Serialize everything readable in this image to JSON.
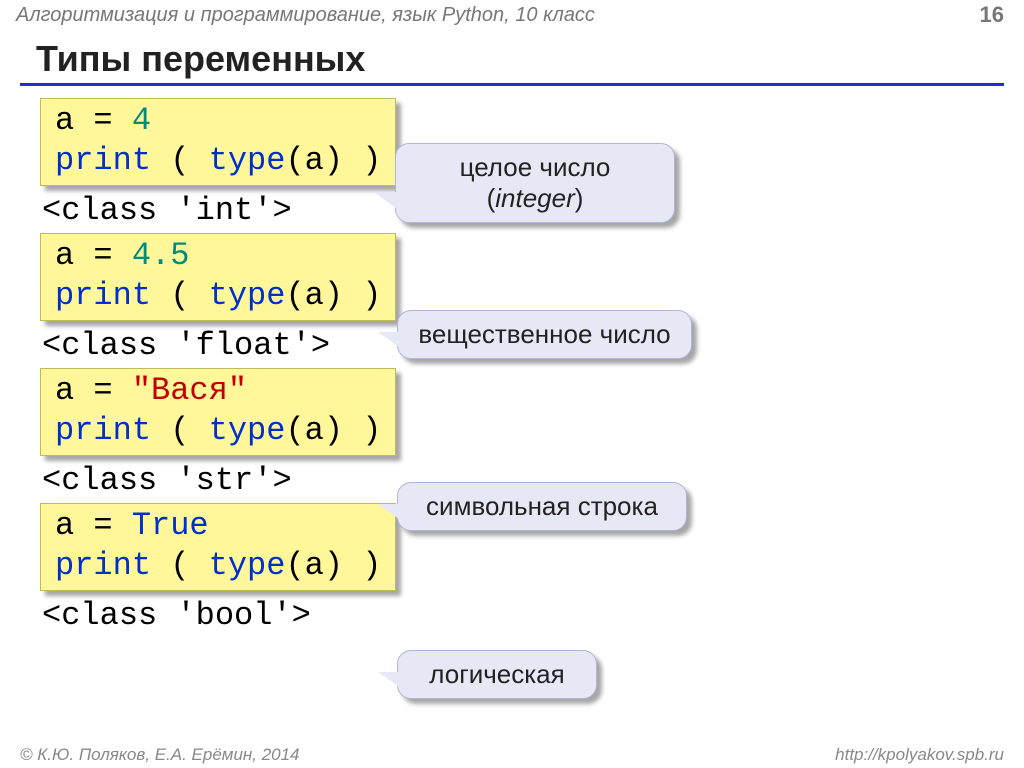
{
  "header": {
    "title": "Алгоритмизация и программирование, язык Python, 10 класс",
    "page": "16"
  },
  "title": "Типы переменных",
  "blocks": [
    {
      "code": {
        "l1_a": "a",
        "l1_eq": " = ",
        "l1_val": "4",
        "l2_print": "print",
        "l2_sp1": " ( ",
        "l2_type": "type",
        "l2_arg": "(a)",
        "l2_sp2": " )"
      },
      "out": "<class 'int'>",
      "bubble_l1": "целое число",
      "bubble_l2a": "(",
      "bubble_l2b": "integer",
      "bubble_l2c": ")"
    },
    {
      "code": {
        "l1_a": "a",
        "l1_eq": " = ",
        "l1_val": "4.5",
        "l2_print": "print",
        "l2_sp1": " ( ",
        "l2_type": "type",
        "l2_arg": "(a)",
        "l2_sp2": " )"
      },
      "out": "<class 'float'>",
      "bubble_l1": "вещественное число"
    },
    {
      "code": {
        "l1_a": "a",
        "l1_eq": " = ",
        "l1_val": "\"Вася\"",
        "l2_print": "print",
        "l2_sp1": " ( ",
        "l2_type": "type",
        "l2_arg": "(a)",
        "l2_sp2": " )"
      },
      "out": "<class 'str'>",
      "bubble_l1": "символьная строка"
    },
    {
      "code": {
        "l1_a": "a",
        "l1_eq": " = ",
        "l1_val": "True",
        "l2_print": "print",
        "l2_sp1": " ( ",
        "l2_type": "type",
        "l2_arg": "(a)",
        "l2_sp2": " )"
      },
      "out": "<class 'bool'>",
      "bubble_l1": "логическая"
    }
  ],
  "footer": {
    "left": "© К.Ю. Поляков, Е.А. Ерёмин, 2014",
    "right": "http://kpolyakov.spb.ru"
  }
}
